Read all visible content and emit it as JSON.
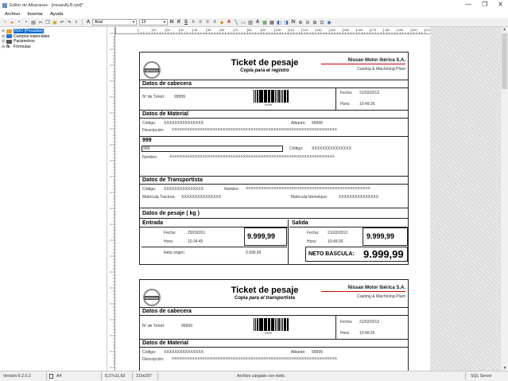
{
  "window": {
    "title": "Editor de Albaranes - [rissanALB.rpd]*",
    "minimize": "—",
    "restore": "❐",
    "close": "✕"
  },
  "menu": [
    "Archivo",
    "Insertar",
    "Ayuda"
  ],
  "toolbar": {
    "font": "Arial",
    "size": "10"
  },
  "tree": [
    {
      "label": "BDO [Pesadas]",
      "selected": true
    },
    {
      "label": "Campos especiales",
      "selected": false
    },
    {
      "label": "Parámetros",
      "selected": false
    },
    {
      "label": "Fórmulas",
      "selected": false
    }
  ],
  "ruler_ticks": [
    "10",
    "20",
    "30",
    "40",
    "50",
    "60",
    "70",
    "80",
    "90",
    "100",
    "110",
    "120",
    "130",
    "140",
    "150",
    "160",
    "170",
    "180",
    "190",
    "200",
    "210"
  ],
  "status": {
    "version": "Versión:6.2.0.2",
    "paper": "A4",
    "size_in": "8,27x11,69",
    "size_mm": "210x297",
    "message": "Archivo cargado con éxito.",
    "db": "SQL Server"
  },
  "ticket1": {
    "logo": "NISSAN",
    "title": "Ticket de pesaje",
    "subtitle": "Copia para el registro",
    "company": "Nissan Motor Ibérica S.A.",
    "plant": "Casting & Machining Plant",
    "cabecera": {
      "title": "Datos de cabecera",
      "ticket_label": "Nº de Ticket:",
      "ticket_value": "99999",
      "barcode_text": "9999",
      "fecha_label": "Fecha:",
      "fecha_value": "21/03/2013",
      "hora_label": "Hora:",
      "hora_value": "10:49:26"
    },
    "material": {
      "title": "Datos de Material",
      "codigo_label": "Código:",
      "codigo_value": "XXXXXXXXXXXXXXX",
      "albaran_label": "Albarán:",
      "albaran_value": "99999",
      "desc_label": "Descripción:",
      "desc_value": "XXXXXXXXXXXXXXXXXXXXXXXXXXXXXXXXXXXXXXXXXXXXXXXXXXXXXXXXXXXXXXXXX"
    },
    "extra": {
      "title": "999",
      "value": "999",
      "codigo_label": "Código:",
      "codigo_value": "XXXXXXXXXXXXXXX",
      "nombre_label": "Nombre:",
      "nombre_value": "XXXXXXXXXXXXXXXXXXXXXXXXXXXXXXXXXXXXXXXXXXXXXXXXXXXXXXXXXXXXXXXXX"
    },
    "transporte": {
      "title": "Datos de Transportista",
      "codigo_label": "Código:",
      "codigo_value": "XXXXXXXXXXXXXXX",
      "nombre_label": "Nombre:",
      "nombre_value": "XXXXXXXXXXXXXXXXXXXXXXXXXXXXXXXXXXXXXXXXXXXXXXXXX",
      "tractora_label": "Matrícula Tractora:",
      "tractora_value": "XXXXXXXXXXXXXXX",
      "remolque_label": "Matrícula Remolque:",
      "remolque_value": "XXXXXXXXXXXXXXX"
    },
    "pesaje": {
      "title": "Datos de pesaje ( kg )",
      "entrada": "Entrada",
      "salida": "Salida",
      "fecha_label": "Fecha:",
      "hora_label": "Hora:",
      "e_fecha": "25/03/201",
      "e_hora": "10:34:45",
      "e_peso": "9.999,99",
      "s_fecha": "21/03/2013",
      "s_hora": "10:49:26",
      "s_peso": "9.999,99",
      "origen_label": "Neto origen",
      "origen_value": "9.999,99",
      "neto_label": "NETO BÁSCULA:",
      "neto_value": "9.999,99"
    }
  },
  "ticket2": {
    "logo": "NISSAN",
    "title": "Ticket de pesaje",
    "subtitle": "Copia para el transportista",
    "company": "Nissan Motor Ibérica S.A.",
    "plant": "Casting & Machining Plant",
    "cabecera": {
      "title": "Datos de cabecera",
      "ticket_label": "Nº de Ticket:",
      "ticket_value": "99999",
      "barcode_text": "9999",
      "fecha_label": "Fecha:",
      "fecha_value": "21/03/2013",
      "hora_label": "Hora:",
      "hora_value": "10:49:26"
    },
    "material": {
      "title": "Datos de Material",
      "codigo_label": "Código:",
      "codigo_value": "XXXXXXXXXXXXXXX",
      "albaran_label": "Albarán:",
      "albaran_value": "99999",
      "desc_label": "Descripción:",
      "desc_value": "XXXXXXXXXXXXXXXXXXXXXXXXXXXXXXXXXXXXXXXXXXXXXXXXXXXXXXXXXXXXXXXXX"
    }
  },
  "colors": {
    "accent": "#0066cc",
    "rule": "#cc0000"
  }
}
